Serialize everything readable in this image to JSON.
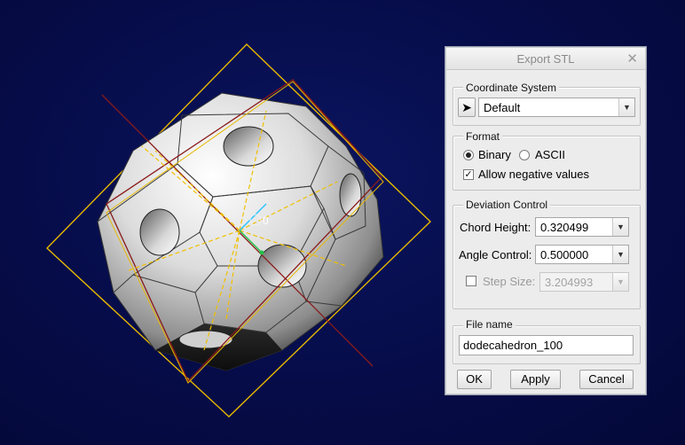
{
  "dialog": {
    "title": "Export STL",
    "close_icon": "close-icon",
    "coordinate_system": {
      "label": "Coordinate System",
      "select_icon": "pointer-arrow-icon",
      "value": "Default"
    },
    "format": {
      "label": "Format",
      "options": [
        "Binary",
        "ASCII"
      ],
      "selected": "Binary",
      "allow_negative_label": "Allow negative values",
      "allow_negative_checked": true
    },
    "deviation": {
      "label": "Deviation Control",
      "chord_height_label": "Chord Height:",
      "chord_height_value": "0.320499",
      "angle_control_label": "Angle Control:",
      "angle_control_value": "0.500000",
      "step_size_label": "Step Size:",
      "step_size_value": "3.204993",
      "step_size_checked": false
    },
    "file_name": {
      "label": "File name",
      "value": "dodecahedron_100"
    },
    "buttons": {
      "ok": "OK",
      "apply": "Apply",
      "cancel": "Cancel"
    }
  },
  "viewport": {
    "background": "#060c48",
    "datum_plane_color": "#e6b800",
    "axis_color": "#8a1a1a",
    "coordinate_system_tag": "0"
  }
}
